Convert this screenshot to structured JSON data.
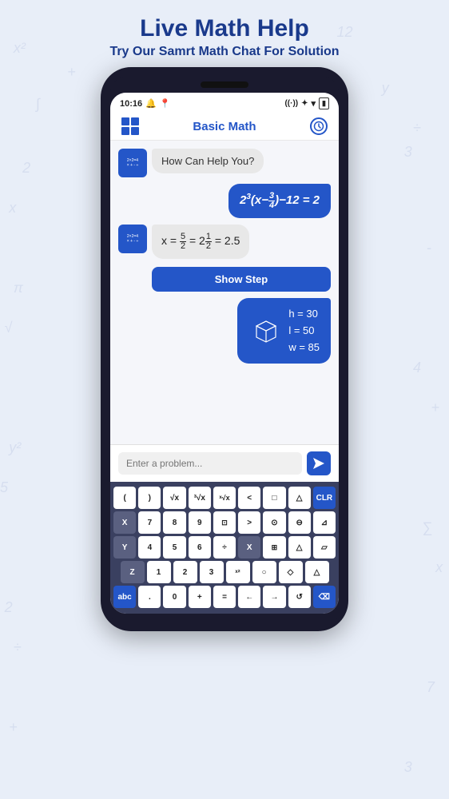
{
  "page": {
    "title": "Live Math Help",
    "subtitle": "Try Our Samrt Math Chat For Solution"
  },
  "status_bar": {
    "time": "10:16",
    "icons_left": [
      "bell-icon",
      "location-icon"
    ],
    "icons_right": [
      "wifi-icon",
      "bluetooth-icon",
      "signal-icon",
      "battery-icon"
    ]
  },
  "navbar": {
    "title": "Basic Math",
    "left_icon": "grid-icon",
    "right_icon": "history-icon"
  },
  "chat": {
    "bot_greeting": "How Can Help You?",
    "user_equation": "2³(x - 3/4) - 12 = 2",
    "answer_text": "x = 5/2 = 2½ = 2.5",
    "show_step_label": "Show Step",
    "box_h": "h = 30",
    "box_l": "l = 50",
    "box_w": "w = 85"
  },
  "input": {
    "placeholder": "Enter a problem..."
  },
  "keyboard": {
    "row1": [
      "(",
      ")",
      "√x",
      "³√x",
      "ˣ√x",
      "<",
      "□",
      "△",
      "CLR"
    ],
    "row2": [
      "X",
      "7",
      "8",
      "9",
      "⊡",
      ">",
      "⊙",
      "⊖",
      "⊿"
    ],
    "row3": [
      "Y",
      "4",
      "5",
      "6",
      "÷",
      "X",
      "⊞",
      "△",
      "▱"
    ],
    "row4": [
      "Z",
      "1",
      "2",
      "3",
      "ˣ²",
      "○",
      "◇",
      "△"
    ],
    "row5": [
      "abc",
      ".",
      "0",
      "+",
      "=",
      "←",
      "→",
      "↺",
      "⌫"
    ]
  }
}
